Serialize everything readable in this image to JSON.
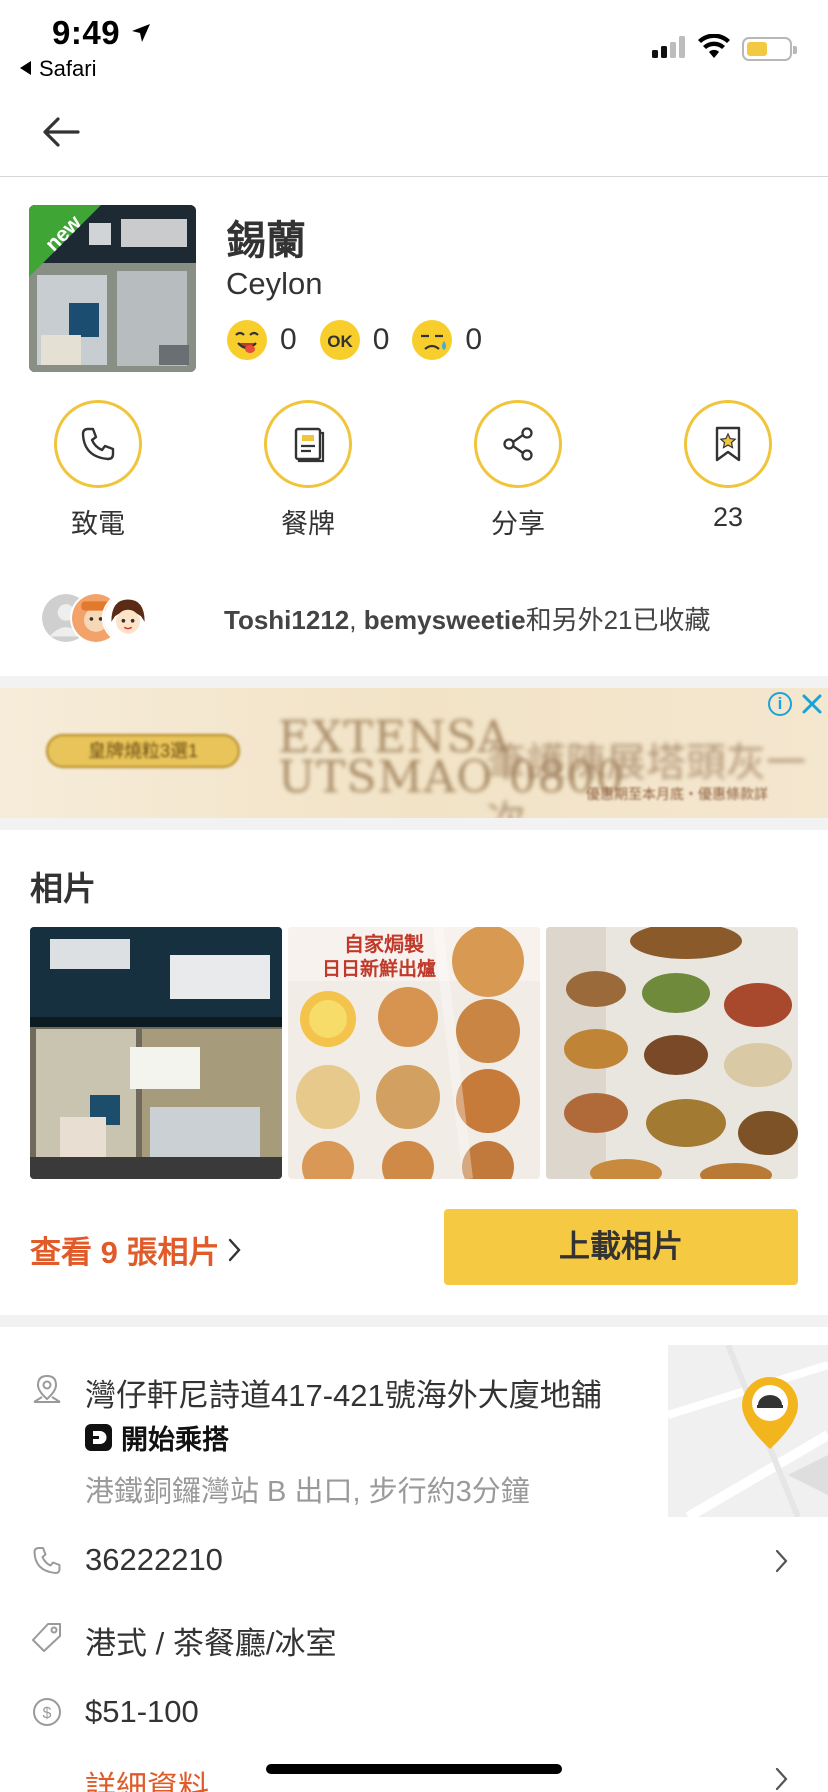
{
  "status_bar": {
    "time": "9:49",
    "back_app": "Safari"
  },
  "restaurant": {
    "name_zh": "錫蘭",
    "name_en": "Ceylon",
    "badge": "new",
    "reactions": [
      {
        "name": "tasty-face-icon",
        "count": "0"
      },
      {
        "name": "ok-icon",
        "count": "0"
      },
      {
        "name": "sad-face-icon",
        "count": "0"
      }
    ]
  },
  "actions": {
    "call": "致電",
    "menu": "餐牌",
    "share": "分享",
    "bookmark_count": "23"
  },
  "bookmarked": {
    "user1": "Toshi1212",
    "separator": ", ",
    "user2": "bemysweetie",
    "suffix": "和另外21已收藏"
  },
  "ad": {
    "pill": "皇牌燒粒3選1",
    "headline": "EXTENSA\nUTSMAO 0800",
    "headline_zh": "筆護陳展塔頭灰一次",
    "fine_print": "優惠期至本月底・優惠條款詳",
    "info_icon": "i"
  },
  "photos": {
    "section_title": "相片",
    "items": [
      {
        "name": "storefront-photo"
      },
      {
        "name": "bakery-menu-photo",
        "caption_top": "自家焗製",
        "caption_bottom": "日日新鮮出爐"
      },
      {
        "name": "dishes-menu-photo"
      }
    ],
    "view_more": "查看 9 張相片",
    "upload": "上載相片"
  },
  "info": {
    "address": "灣仔軒尼詩道417-421號海外大廈地舖",
    "ride_label": "開始乘搭",
    "directions": "港鐵銅鑼灣站 B 出口, 步行約3分鐘",
    "phone": "36222210",
    "cuisine": "港式 / 茶餐廳/冰室",
    "price": "$51-100",
    "details": "詳細資料"
  },
  "colors": {
    "accent_yellow": "#f5c942",
    "accent_orange": "#e15b2a",
    "icon_ring": "#f0c53b"
  }
}
